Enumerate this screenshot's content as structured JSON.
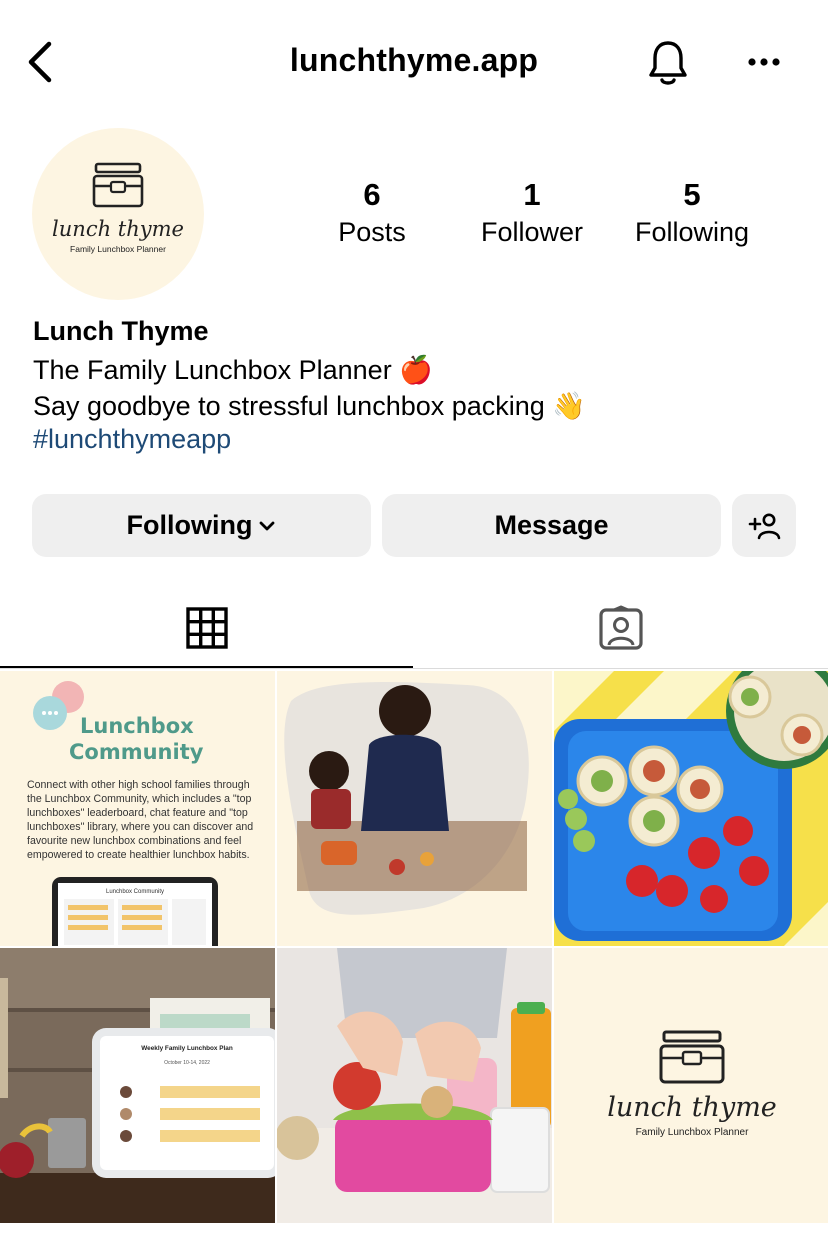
{
  "header": {
    "username": "lunchthyme.app",
    "back_icon": "chevron-left-icon",
    "notifications_icon": "bell-icon",
    "more_icon": "ellipsis-icon"
  },
  "profile": {
    "display_name": "Lunch Thyme",
    "bio_line_1": "The Family Lunchbox Planner 🍎",
    "bio_line_2": "Say goodbye to stressful lunchbox packing 👋",
    "hashtag": "#lunchthymeapp",
    "avatar_logo": {
      "wordmark": "lunch thyme",
      "tagline": "Family Lunchbox Planner"
    }
  },
  "stats": [
    {
      "value": "6",
      "label": "Posts"
    },
    {
      "value": "1",
      "label": "Follower"
    },
    {
      "value": "5",
      "label": "Following"
    }
  ],
  "actions": {
    "following_label": "Following",
    "message_label": "Message",
    "suggest_icon": "add-person-icon"
  },
  "tabs": [
    {
      "icon": "grid-icon",
      "selected": true
    },
    {
      "icon": "tagged-icon",
      "selected": false
    }
  ],
  "posts": {
    "post1": {
      "title_1": "Lunchbox",
      "title_2": "Community",
      "body_1": "Connect with other high school families through",
      "body_2": "the Lunchbox Community, which includes a \"top",
      "body_3": "lunchboxes\" leaderboard, chat feature and \"top",
      "body_4": "lunchboxes\" library, where you can discover and",
      "body_5": "favourite new lunchbox combinations and feel",
      "body_6": "empowered to create healthier lunchbox habits.",
      "screen_title": "Lunchbox Community"
    },
    "post4": {
      "screen_title": "Weekly Family Lunchbox Plan",
      "screen_date": "October 10-14, 2022"
    },
    "post6": {
      "wordmark": "lunch thyme",
      "tagline": "Family Lunchbox Planner"
    }
  },
  "colors": {
    "cream": "#fdf5e2",
    "teal_heading": "#4f9a8a",
    "hashtag": "#1e4a76",
    "button_bg": "#efefef"
  }
}
